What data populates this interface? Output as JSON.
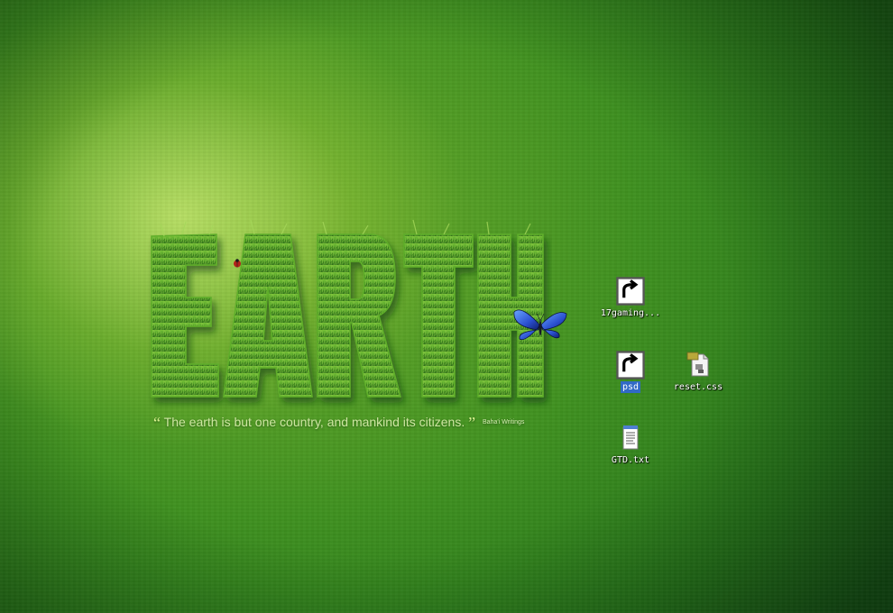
{
  "wallpaper": {
    "title_word": "EARTH",
    "quote_text": "The earth is but one country, and mankind its citizens.",
    "quote_open": "“",
    "quote_close": "”",
    "attribution": "Baha'i Writings"
  },
  "desktop_icons": [
    {
      "label": "17gaming...",
      "icon": "folder-shortcut-icon",
      "selected": false
    },
    {
      "label": "psd",
      "icon": "folder-shortcut-icon",
      "selected": true
    },
    {
      "label": "reset.css",
      "icon": "css-file-icon",
      "selected": false
    },
    {
      "label": "GTD.txt",
      "icon": "text-file-icon",
      "selected": false
    }
  ],
  "colors": {
    "background_light": "#b9dc6a",
    "background_mid": "#3f9120",
    "background_dark": "#16541a",
    "grass": "#4a9a23",
    "selection": "#316ac5"
  }
}
